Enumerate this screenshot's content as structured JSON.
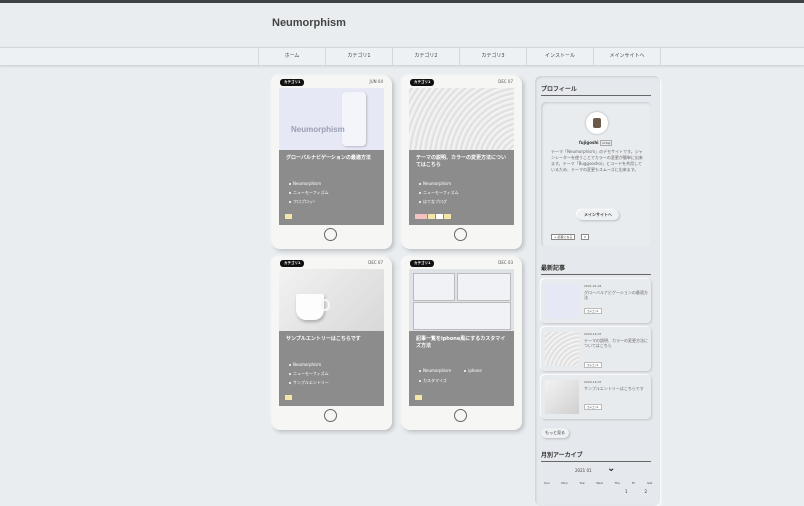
{
  "site": {
    "title": "Neumorphism"
  },
  "nav": {
    "items": [
      "ホーム",
      "カテゴリ1",
      "カテゴリ2",
      "カテゴリ3",
      "インストール",
      "メインサイトへ"
    ]
  },
  "cards": [
    {
      "category": "カテゴリ1",
      "date": "JUN 04",
      "thumb_text": "Neumorphism",
      "title": "グローバルナビゲーションの最適方法",
      "tags": [
        "Neumorphism",
        "ニューモーフィズム",
        "フロブロッ！"
      ]
    },
    {
      "category": "カテゴリ1",
      "date": "DEC 07",
      "title": "テーマの説明、カラーの変更方法についてはこちら",
      "tags": [
        "Neumorphism",
        "ニューモーフィズム",
        "はてなブログ"
      ]
    },
    {
      "category": "カテゴリ1",
      "date": "DEC 07",
      "title": "サンプルエントリーはこちらです",
      "tags": [
        "Neumorphism",
        "ニューモーフィズム",
        "サンプルエントリー"
      ]
    },
    {
      "category": "カテゴリ1",
      "date": "DEC 03",
      "title": "記事一覧をiphone風にするカスタマイズ方法",
      "tags": [
        "Neumorphism",
        "iphone",
        "カスタマイズ"
      ]
    }
  ],
  "sidebar": {
    "profile_heading": "プロフィール",
    "profile_name": "fujigoshi",
    "profile_badge": "id:fuji",
    "profile_text": "テーマ「Neumorphism」のデモサイトです。ジャンレーターを使うことでカラーの変更が簡単に出来ます。テーマ「Buggooshoi」とコードを共用しているため、テーマの変更もスムーズに出来ます。",
    "profile_button": "メインサイトへ",
    "follow_label": "読者になる",
    "follow_count": "2",
    "recent_heading": "最新記事",
    "recent": [
      {
        "date": "2021-01-04",
        "title": "グローバルナビゲーションの最適方法",
        "tag": "カテゴリ1"
      },
      {
        "date": "2020-12-07",
        "title": "テーマの説明、カラーの変更方法についてはこちら",
        "tag": "カテゴリ1"
      },
      {
        "date": "2020-12-07",
        "title": "サンプルエントリーはこちらです",
        "tag": "カテゴリ1"
      }
    ],
    "more_label": "もっと見る",
    "archive_heading": "月別アーカイブ",
    "month": "2021 01",
    "weekdays": [
      "Sun",
      "Mon",
      "Tue",
      "Wed",
      "Thu",
      "Fri",
      "Sat"
    ],
    "first_days": [
      "1",
      "2"
    ]
  },
  "colors": {
    "background": "#e9edf0",
    "card": "#f6f6f4",
    "screen": "#8c8c8c",
    "badge": "#111111"
  }
}
